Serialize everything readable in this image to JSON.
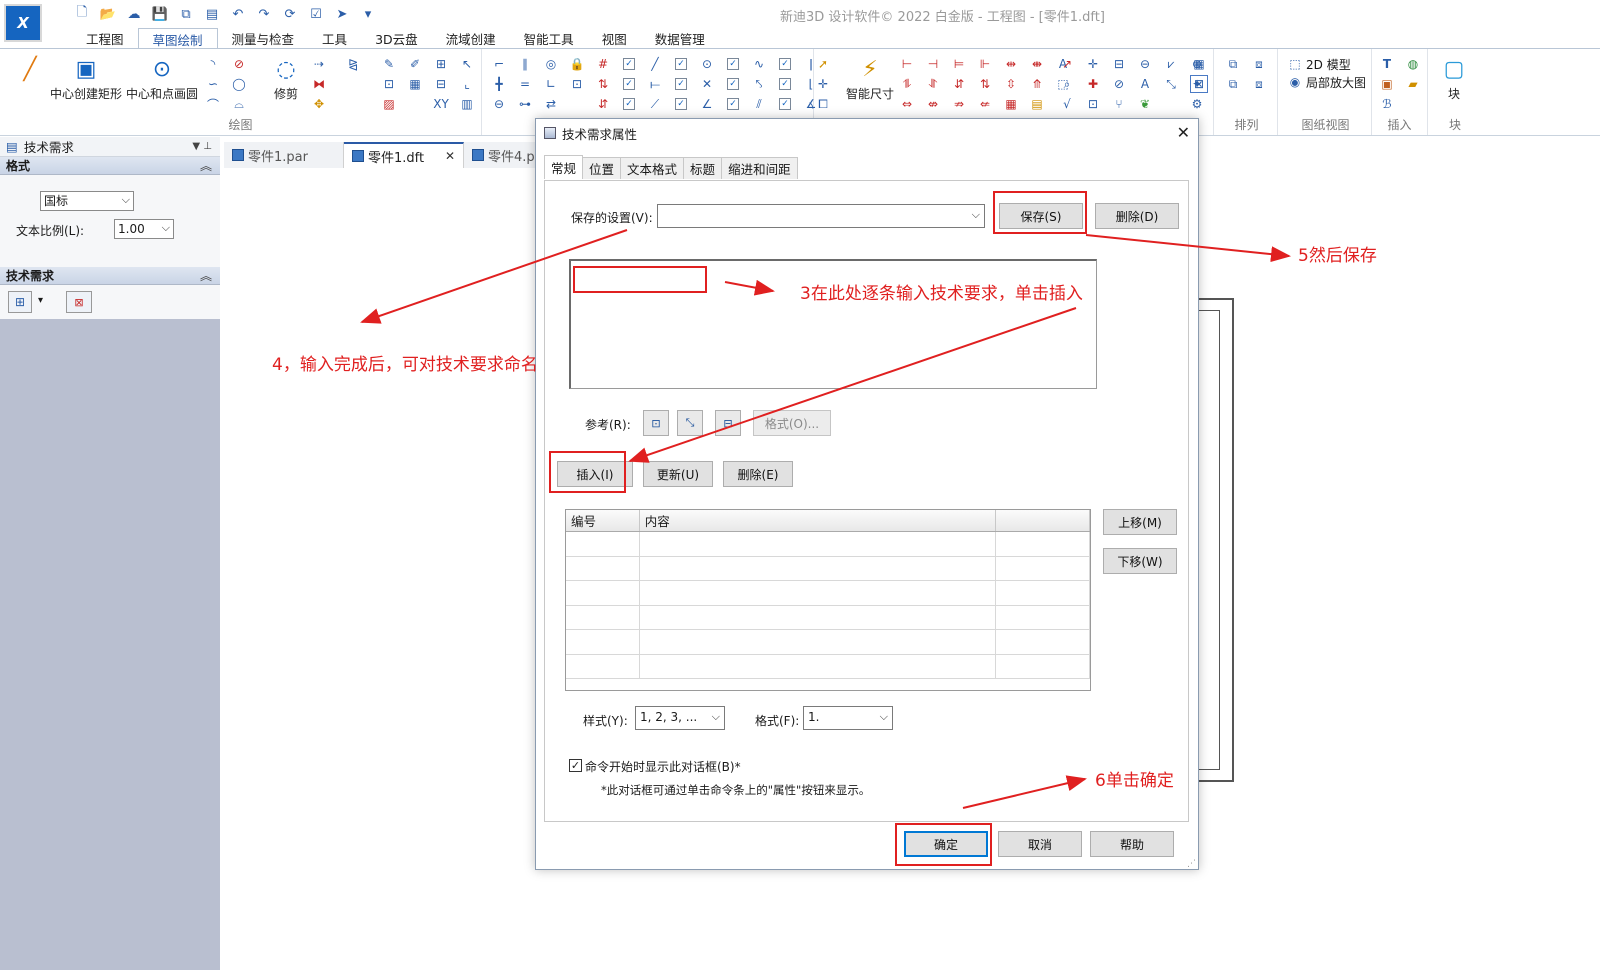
{
  "window": {
    "title": "新迪3D 设计软件© 2022 白金版 - 工程图 - [零件1.dft]",
    "logo_text": "X"
  },
  "ribbon": {
    "tabs": [
      "工程图",
      "草图绘制",
      "测量与检查",
      "工具",
      "3D云盘",
      "流域创建",
      "智能工具",
      "视图",
      "数据管理"
    ],
    "active_tab": "草图绘制",
    "buttons": {
      "center_rect": "中心创建矩形",
      "center_circle": "中心和点画圆",
      "trim": "修剪",
      "smart_dim": "智能尺寸",
      "model_2d": "2D 模型",
      "local_zoom": "局部放大图",
      "block": "块"
    },
    "groups": {
      "draw": "绘图",
      "arrange": "排列",
      "sheet_view": "图纸视图",
      "insert": "插入",
      "block": "块"
    }
  },
  "left_panel": {
    "title": "技术需求",
    "format_section": "格式",
    "standard": "国标",
    "text_scale_label": "文本比例(L):",
    "text_scale_value": "1.00",
    "tech_section": "技术需求"
  },
  "doc_tabs": [
    {
      "label": "零件1.par"
    },
    {
      "label": "零件1.dft"
    },
    {
      "label": "零件4.p"
    }
  ],
  "dialog": {
    "title": "技术需求属性",
    "tabs": [
      "常规",
      "位置",
      "文本格式",
      "标题",
      "缩进和间距"
    ],
    "active_tab": "常规",
    "saved_settings_label": "保存的设置(V):",
    "saved_settings_value": "",
    "save_button": "保存(S)",
    "delete_top_button": "删除(D)",
    "reference_label": "参考(R):",
    "format_button": "格式(O)...",
    "insert_button": "插入(I)",
    "update_button": "更新(U)",
    "delete_button": "删除(E)",
    "table": {
      "columns": [
        "编号",
        "内容",
        ""
      ],
      "rows": 6
    },
    "move_up_button": "上移(M)",
    "move_down_button": "下移(W)",
    "style_label": "样式(Y):",
    "style_value": "1, 2, 3, ...",
    "format_label": "格式(F):",
    "format_value": "1.",
    "show_dialog_checkbox": "命令开始时显示此对话框(B)*",
    "show_dialog_checked": true,
    "note": "*此对话框可通过单击命令条上的\"属性\"按钮来显示。",
    "ok_button": "确定",
    "cancel_button": "取消",
    "help_button": "帮助"
  },
  "annotations": {
    "step3": "3在此处逐条输入技术要求，单击插入",
    "step4": "4，输入完成后，可对技术要求命名",
    "step5": "5然后保存",
    "step6": "6单击确定",
    "color": "#e02020"
  }
}
